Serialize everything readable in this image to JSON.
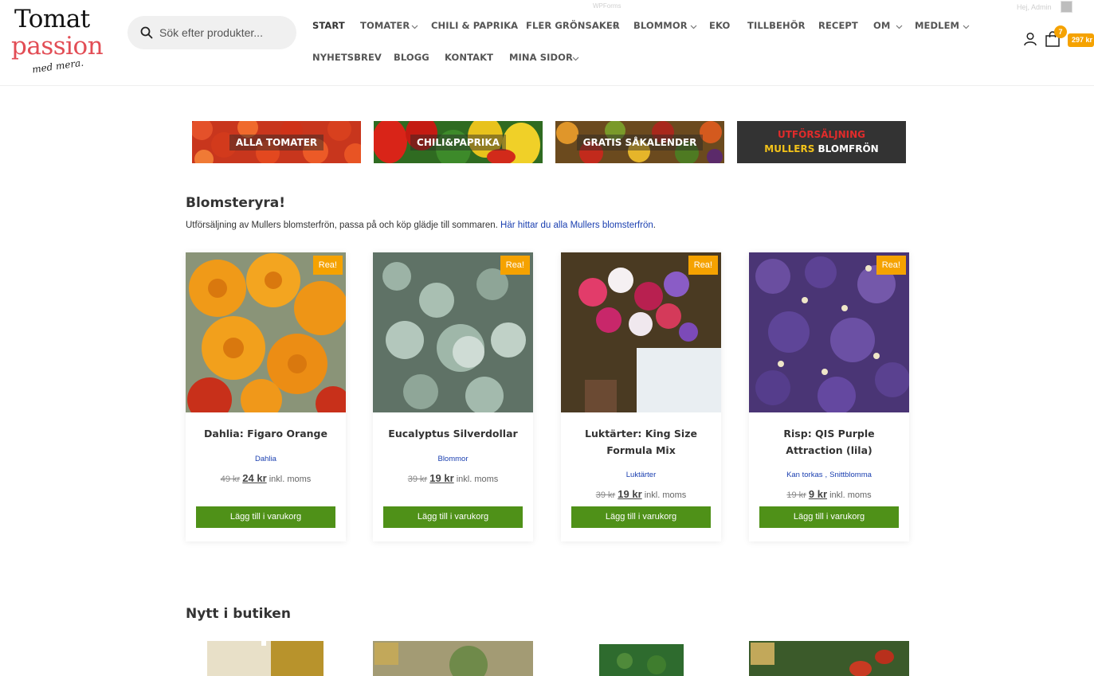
{
  "header": {
    "logo": {
      "line1": "Tomat",
      "line2": "passion",
      "line3": "med mera."
    },
    "search": {
      "placeholder": "Sök efter produkter..."
    },
    "nav_row1": [
      {
        "label": "START",
        "has_dropdown": false,
        "active": true
      },
      {
        "label": "TOMATER",
        "has_dropdown": true
      },
      {
        "label": "CHILI & PAPRIKA",
        "has_dropdown": false
      },
      {
        "label": "FLER GRÖNSAKER",
        "has_dropdown": true
      },
      {
        "label": "BLOMMOR",
        "has_dropdown": true
      },
      {
        "label": "EKO",
        "has_dropdown": false
      },
      {
        "label": "TILLBEHÖR",
        "has_dropdown": false
      },
      {
        "label": "RECEPT",
        "has_dropdown": false
      },
      {
        "label": "OM",
        "has_dropdown": true
      },
      {
        "label": "MEDLEM",
        "has_dropdown": true
      }
    ],
    "nav_row2": [
      {
        "label": "NYHETSBREV",
        "has_dropdown": false
      },
      {
        "label": "BLOGG",
        "has_dropdown": false
      },
      {
        "label": "KONTAKT",
        "has_dropdown": false
      },
      {
        "label": "MINA SIDOR",
        "has_dropdown": true
      }
    ],
    "wpforms_label": "WPForms",
    "greeting": "Hej, Admin",
    "cart": {
      "count": "7",
      "total": "297 kr"
    },
    "icons": {
      "search": "search-icon",
      "user": "user-icon",
      "cart": "shopping-bag-icon"
    }
  },
  "banners": [
    {
      "label": "ALLA TOMATER"
    },
    {
      "label": "CHILI&PAPRIKA"
    },
    {
      "label": "GRATIS SÅKALENDER"
    },
    {
      "line1": "UTFÖRSÄLJNING",
      "line2_a": "MULLERS",
      "line2_b": " BLOMFRÖN"
    }
  ],
  "section1": {
    "title": "Blomsteryra!",
    "text": "Utförsäljning av Mullers blomsterfrön, passa på och köp glädje till sommaren. ",
    "link": "Här hittar du alla Mullers blomsterfrön",
    "link_suffix": "."
  },
  "products": [
    {
      "name": "Dahlia: Figaro Orange",
      "categories": [
        "Dahlia"
      ],
      "old_price": "49 kr",
      "new_price": "24 kr",
      "suffix": "inkl. moms",
      "badge": "Rea!",
      "button": "Lägg till i varukorg"
    },
    {
      "name": "Eucalyptus Silverdollar",
      "categories": [
        "Blommor"
      ],
      "old_price": "39 kr",
      "new_price": "19 kr",
      "suffix": "inkl. moms",
      "badge": "Rea!",
      "button": "Lägg till i varukorg"
    },
    {
      "name": "Luktärter: King Size Formula Mix",
      "categories": [
        "Luktärter"
      ],
      "old_price": "39 kr",
      "new_price": "19 kr",
      "suffix": "inkl. moms",
      "badge": "Rea!",
      "button": "Lägg till i varukorg"
    },
    {
      "name": "Risp: QIS Purple Attraction (lila)",
      "categories": [
        "Kan torkas",
        "Snittblomma"
      ],
      "old_price": "19 kr",
      "new_price": "9 kr",
      "suffix": "inkl. moms",
      "badge": "Rea!",
      "button": "Lägg till i varukorg"
    }
  ],
  "section2": {
    "title": "Nytt i butiken"
  },
  "colors": {
    "accent_orange": "#f5a200",
    "button_green": "#4f9118",
    "link_blue": "#1a3fb0",
    "logo_red": "#e24d55"
  }
}
